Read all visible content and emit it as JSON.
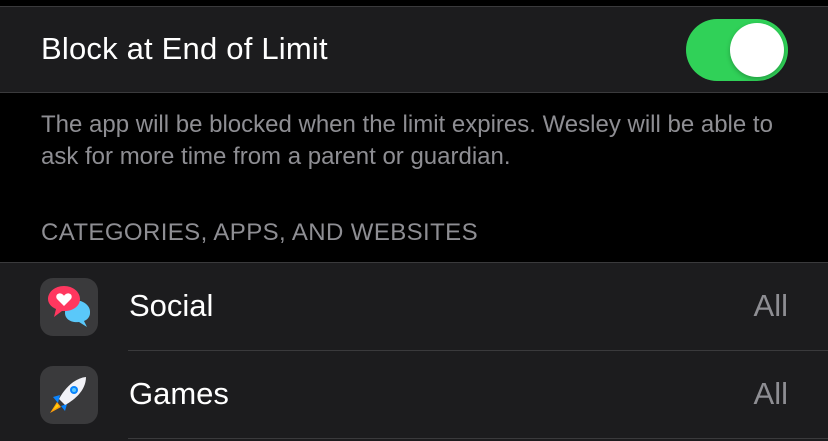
{
  "block_setting": {
    "label": "Block at End of Limit",
    "enabled": true,
    "toggle_color": "#30d158",
    "footer": "The app will be blocked when the limit expires. Wesley will be able to ask for more time from a parent or guardian."
  },
  "categories_section": {
    "header": "CATEGORIES, APPS, AND WEBSITES",
    "items": [
      {
        "icon": "social-bubbles-icon",
        "label": "Social",
        "value": "All"
      },
      {
        "icon": "rocket-icon",
        "label": "Games",
        "value": "All"
      }
    ]
  },
  "colors": {
    "background": "#000000",
    "cell_background": "#1c1c1e",
    "secondary_text": "#8e8e93",
    "separator": "#3a3a3c"
  }
}
